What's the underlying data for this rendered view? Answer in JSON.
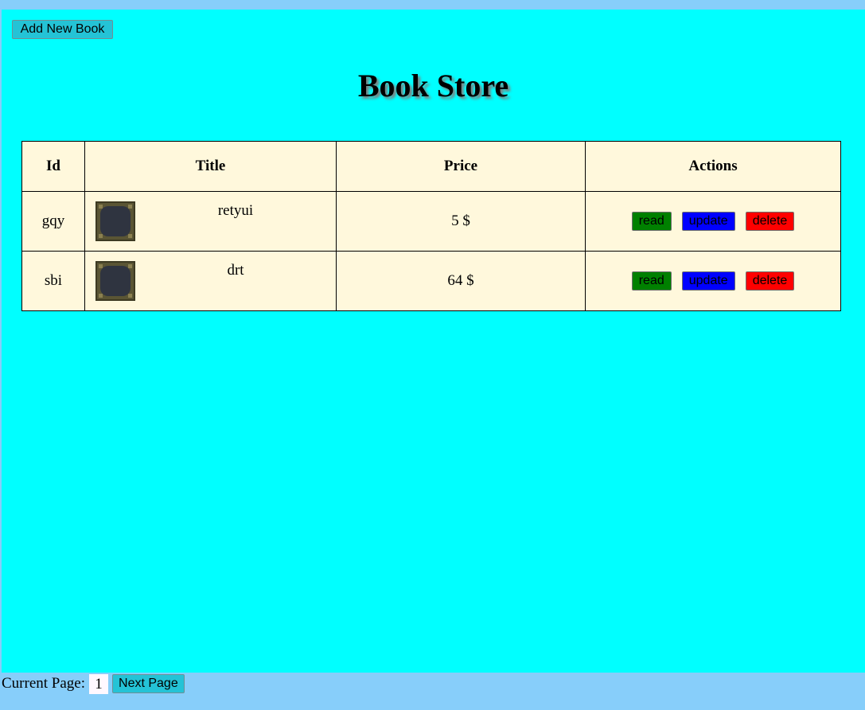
{
  "toolbar": {
    "add_label": "Add New Book"
  },
  "page_title": "Book Store",
  "table": {
    "headers": [
      "Id",
      "Title",
      "Price",
      "Actions"
    ],
    "rows": [
      {
        "id": "gqy",
        "title": "retyui",
        "price": "5 $"
      },
      {
        "id": "sbi",
        "title": "drt",
        "price": "64 $"
      }
    ],
    "actions": {
      "read": "read",
      "update": "update",
      "delete": "delete"
    }
  },
  "pager": {
    "label": "Current Page:",
    "current": "1",
    "next_label": "Next Page"
  },
  "colors": {
    "page_bg": "#00ffff",
    "outer_bg": "#87cefa",
    "table_bg": "#fff8dc",
    "read": "#008000",
    "update": "#0000ff",
    "delete": "#ff0000",
    "button": "#24c3d6"
  },
  "icons": {
    "cover": "book-cover-icon"
  }
}
